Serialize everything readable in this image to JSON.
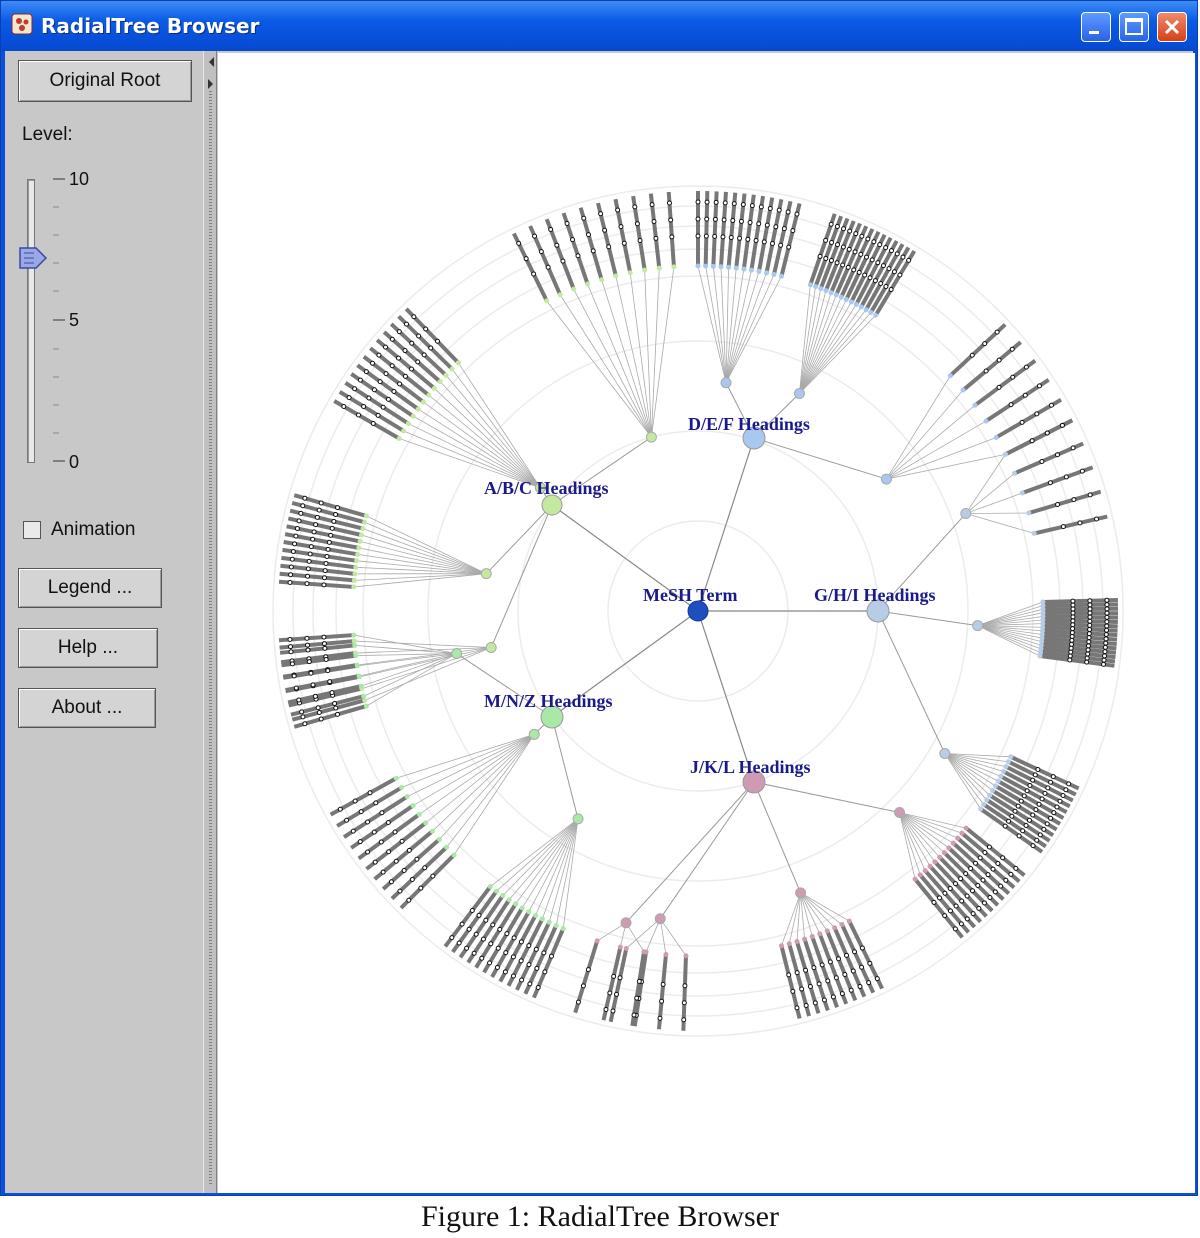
{
  "window": {
    "title": "RadialTree Browser",
    "controls": [
      "minimize",
      "maximize",
      "close"
    ]
  },
  "sidebar": {
    "original_root_label": "Original Root",
    "level_label": "Level:",
    "slider": {
      "max_label": "10",
      "mid_label": "5",
      "min_label": "0",
      "value": 7
    },
    "animation_label": "Animation",
    "animation_checked": false,
    "legend_label": "Legend ...",
    "help_label": "Help ...",
    "about_label": "About ..."
  },
  "tree": {
    "root": {
      "label": "MeSH Term",
      "color": "#1f4fbf"
    },
    "branches": [
      {
        "label": "A/B/C Headings",
        "color": "#c4e8a0"
      },
      {
        "label": "D/E/F Headings",
        "color": "#a9c8f0"
      },
      {
        "label": "G/H/I Headings",
        "color": "#b9cce6"
      },
      {
        "label": "J/K/L Headings",
        "color": "#cf9bb3"
      },
      {
        "label": "M/N/Z Headings",
        "color": "#aae8a8"
      }
    ]
  },
  "caption": "Figure 1: RadialTree Browser"
}
